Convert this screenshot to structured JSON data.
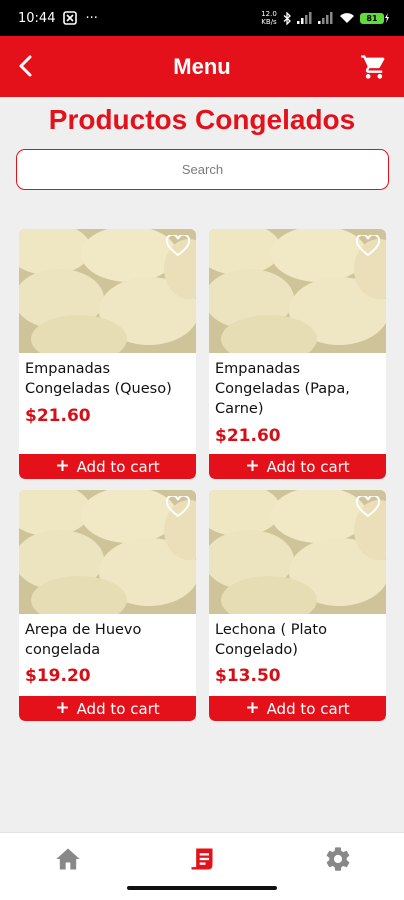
{
  "status_bar": {
    "time": "10:44",
    "dots": "···",
    "data_speed": "12.0 KB/s",
    "battery": "81"
  },
  "header": {
    "title": "Menu"
  },
  "page": {
    "heading": "Productos Congelados"
  },
  "search": {
    "placeholder": "Search"
  },
  "products": [
    {
      "name": "Empanadas Congeladas (Queso)",
      "price": "$21.60",
      "button": "Add to cart"
    },
    {
      "name": "Empanadas Congeladas (Papa, Carne)",
      "price": "$21.60",
      "button": "Add to cart"
    },
    {
      "name": "Arepa de Huevo congelada",
      "price": "$19.20",
      "button": "Add to cart"
    },
    {
      "name": "Lechona ( Plato Congelado)",
      "price": "$13.50",
      "button": "Add to cart"
    }
  ],
  "bottom_nav": {
    "items": [
      {
        "icon": "home-icon",
        "active": false
      },
      {
        "icon": "menu-icon",
        "active": true
      },
      {
        "icon": "settings-icon",
        "active": false
      }
    ]
  },
  "colors": {
    "brand_red": "#e4111b",
    "background": "#efefef",
    "inactive_icon": "#888888"
  }
}
